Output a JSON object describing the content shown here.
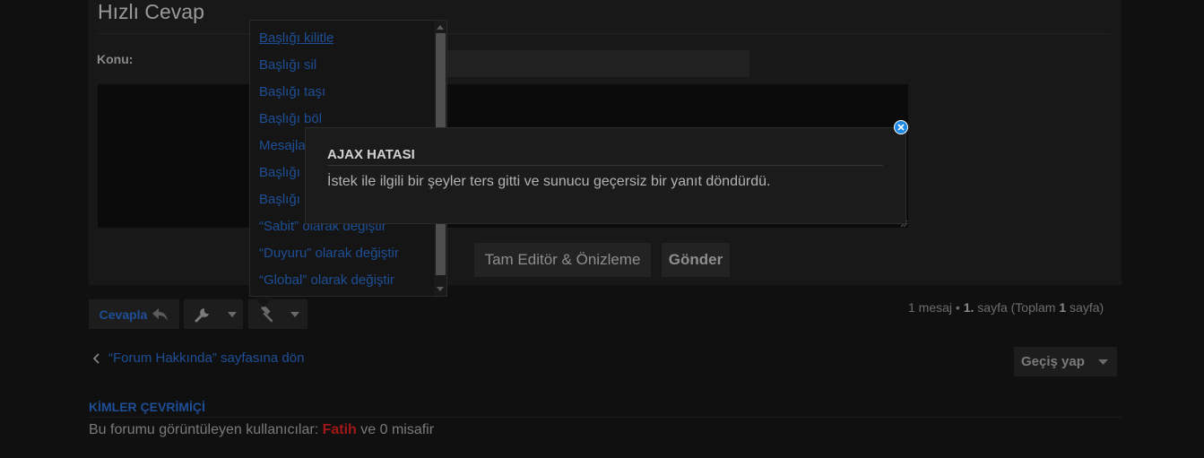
{
  "quick_reply": {
    "title": "Hızlı Cevap",
    "subject_label": "Konu:",
    "full_editor_label": "Tam Editör & Önizleme",
    "send_label": "Gönder"
  },
  "toolbar": {
    "reply_label": "Cevapla",
    "pagination": {
      "count_text": "1 mesaj",
      "bullet": "•",
      "page_number": "1.",
      "page_word": "sayfa (Toplam",
      "total_pages": "1",
      "total_word": "sayfa)"
    }
  },
  "moderation_menu": {
    "items": [
      "Başlığı kilitle",
      "Başlığı sil",
      "Başlığı taşı",
      "Başlığı böl",
      "Mesajla",
      "Başlığı",
      "Başlığı",
      "“Sabit” olarak değiştir",
      "“Duyuru” olarak değiştir",
      "“Global” olarak değiştir"
    ]
  },
  "navigation": {
    "back_link": "“Forum Hakkında” sayfasına dön",
    "jump_label": "Geçiş yap"
  },
  "online": {
    "title": "KİMLER ÇEVRİMİÇİ",
    "prefix": "Bu forumu görüntüleyen kullanıcılar:",
    "user": "Fatih",
    "suffix": "ve 0 misafir"
  },
  "alert": {
    "title": "AJAX HATASI",
    "message": "İstek ile ilgili bir şeyler ters gitti ve sunucu geçersiz bir yanıt döndürdü."
  },
  "colors": {
    "background": "#101010",
    "panel": "#181818",
    "link": "#1e4f96",
    "username": "#a11818",
    "close_button": "#1e88e5"
  },
  "icons": [
    "reply-arrow-icon",
    "wrench-icon",
    "caret-down-icon",
    "hammer-icon",
    "chevron-left-icon",
    "close-icon",
    "resize-grip-icon"
  ]
}
